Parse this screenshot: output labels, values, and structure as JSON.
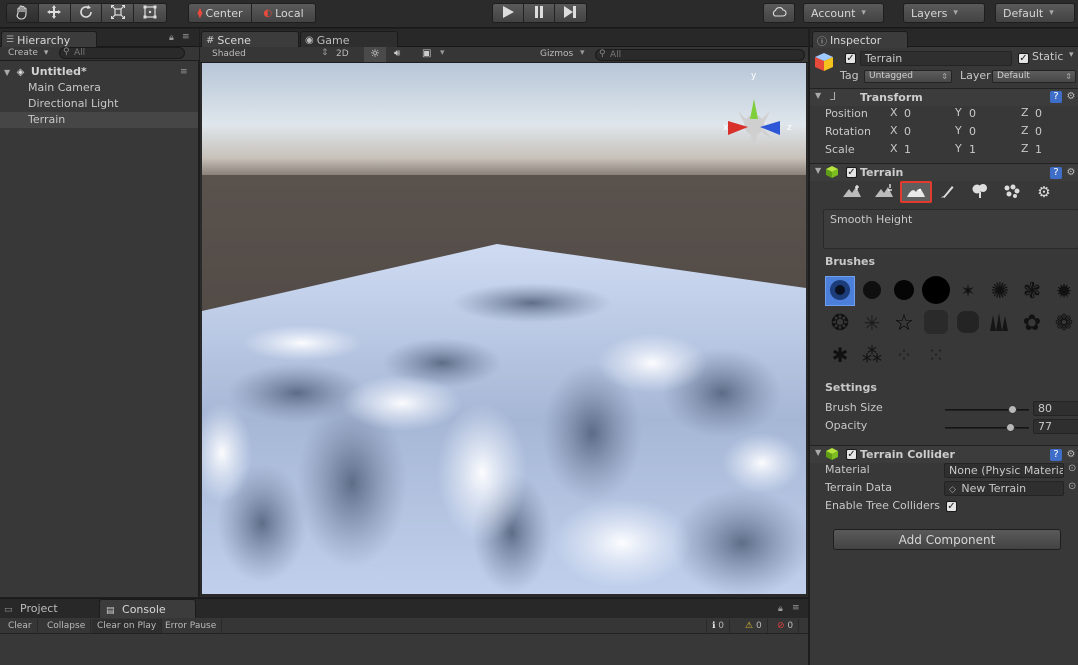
{
  "toolbar": {
    "pivot_label": "Center",
    "space_label": "Local",
    "account_label": "Account",
    "layers_label": "Layers",
    "layout_label": "Default"
  },
  "hierarchy": {
    "tab": "Hierarchy",
    "create_label": "Create",
    "search_placeholder": "All",
    "scene_name": "Untitled*",
    "items": [
      "Main Camera",
      "Directional Light",
      "Terrain"
    ],
    "selected": "Terrain"
  },
  "scene": {
    "tab_scene": "Scene",
    "tab_game": "Game",
    "shading": "Shaded",
    "mode_2d": "2D",
    "gizmos_label": "Gizmos",
    "search_placeholder": "All",
    "gizmo_axes": {
      "y": "y",
      "x": "x",
      "z": "z"
    }
  },
  "console": {
    "tab_project": "Project",
    "tab_console": "Console",
    "buttons": [
      "Clear",
      "Collapse",
      "Clear on Play",
      "Error Pause"
    ],
    "counts": {
      "info": "0",
      "warnings": "0",
      "errors": "0"
    }
  },
  "inspector": {
    "tab": "Inspector",
    "object_name": "Terrain",
    "static_label": "Static",
    "tag_label": "Tag",
    "tag_value": "Untagged",
    "layer_label": "Layer",
    "layer_value": "Default",
    "transform": {
      "title": "Transform",
      "rows": [
        {
          "label": "Position",
          "x": "0",
          "y": "0",
          "z": "0"
        },
        {
          "label": "Rotation",
          "x": "0",
          "y": "0",
          "z": "0"
        },
        {
          "label": "Scale",
          "x": "1",
          "y": "1",
          "z": "1"
        }
      ],
      "axis_labels": {
        "x": "X",
        "y": "Y",
        "z": "Z"
      }
    },
    "terrain": {
      "title": "Terrain",
      "selected_tool_index": 2,
      "tool_description": "Smooth Height",
      "brushes_label": "Brushes",
      "settings_label": "Settings",
      "brush_size_label": "Brush Size",
      "brush_size_value": "80",
      "brush_size_fraction": 0.8,
      "opacity_label": "Opacity",
      "opacity_value": "77",
      "opacity_fraction": 0.77
    },
    "collider": {
      "title": "Terrain Collider",
      "material_label": "Material",
      "material_value": "None (Physic Material",
      "terrain_data_label": "Terrain Data",
      "terrain_data_value": "New Terrain",
      "enable_trees_label": "Enable Tree Colliders"
    },
    "add_component_label": "Add Component"
  },
  "colors": {
    "selection_highlight": "#e23a2c",
    "panel_bg": "#383838",
    "toolbar_bg": "#2b2b2b"
  }
}
